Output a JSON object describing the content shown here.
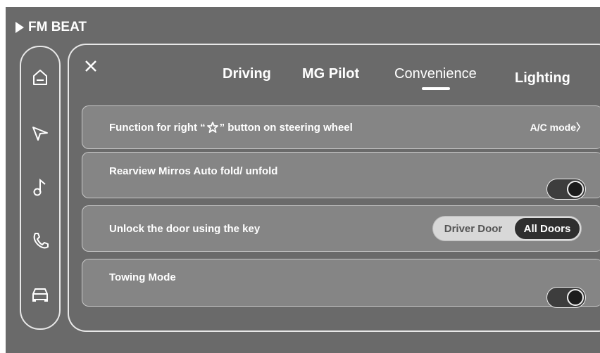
{
  "source": {
    "title": "FM BEAT"
  },
  "sidebar": {
    "items": [
      {
        "icon": "home-icon"
      },
      {
        "icon": "navigation-icon"
      },
      {
        "icon": "music-note-icon"
      },
      {
        "icon": "phone-icon"
      },
      {
        "icon": "car-icon"
      }
    ]
  },
  "header": {
    "close_icon": "close-icon",
    "tabs": [
      {
        "label": "Driving",
        "active": false
      },
      {
        "label": "MG Pilot",
        "active": false
      },
      {
        "label": "Convenience",
        "active": true
      },
      {
        "label": "Lighting",
        "active": false
      }
    ]
  },
  "settings": {
    "rows": [
      {
        "label_before": "Function for right “",
        "star_icon": "star-icon",
        "label_after": "” button on steering wheel",
        "value": "A/C mode〉"
      },
      {
        "label": "Rearview Mirros Auto fold/ unfold",
        "toggle_on": true
      },
      {
        "label": "Unlock the door using the key",
        "options": [
          "Driver Door",
          "All Doors"
        ],
        "selected": "All Doors"
      },
      {
        "label": "Towing Mode",
        "toggle_on": true
      }
    ]
  }
}
